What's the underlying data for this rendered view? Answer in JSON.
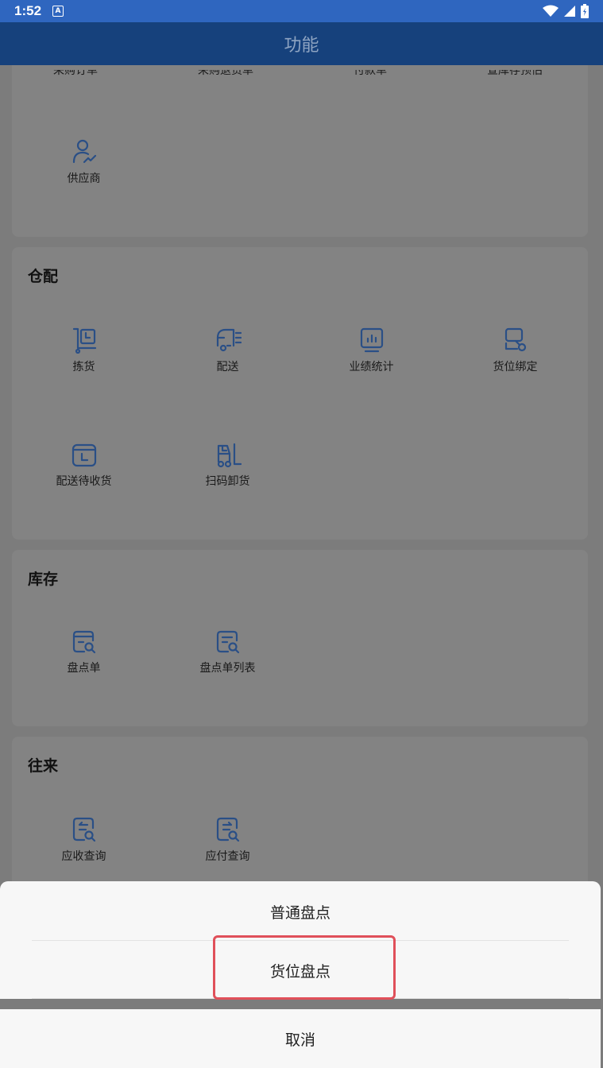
{
  "status_bar": {
    "time": "1:52",
    "notification_icon": "A"
  },
  "appbar": {
    "title": "功能"
  },
  "top_card": {
    "partial_labels": [
      "采购订单",
      "采购退货单",
      "付款单",
      "查库存预估"
    ],
    "items": [
      {
        "label": "供应商",
        "icon": "supplier-icon"
      }
    ]
  },
  "warehouse": {
    "title": "仓配",
    "items": [
      {
        "label": "拣货",
        "icon": "picking-cart-icon"
      },
      {
        "label": "配送",
        "icon": "delivery-truck-icon"
      },
      {
        "label": "业绩统计",
        "icon": "performance-chart-icon"
      },
      {
        "label": "货位绑定",
        "icon": "location-bind-icon"
      },
      {
        "label": "配送待收货",
        "icon": "pending-receive-icon"
      },
      {
        "label": "扫码卸货",
        "icon": "forklift-icon"
      }
    ]
  },
  "inventory": {
    "title": "库存",
    "items": [
      {
        "label": "盘点单",
        "icon": "stocktake-icon"
      },
      {
        "label": "盘点单列表",
        "icon": "stocktake-list-icon"
      }
    ]
  },
  "accounts": {
    "title": "往来",
    "items": [
      {
        "label": "应收查询",
        "icon": "receivable-query-icon"
      },
      {
        "label": "应付查询",
        "icon": "payable-query-icon"
      }
    ]
  },
  "action_sheet": {
    "options": [
      "普通盘点",
      "货位盘点"
    ],
    "cancel": "取消",
    "highlighted": "货位盘点"
  },
  "colors": {
    "icon_blue": "#2a4f86",
    "highlight_red": "#e0505a",
    "appbar_blue": "#16417c"
  }
}
